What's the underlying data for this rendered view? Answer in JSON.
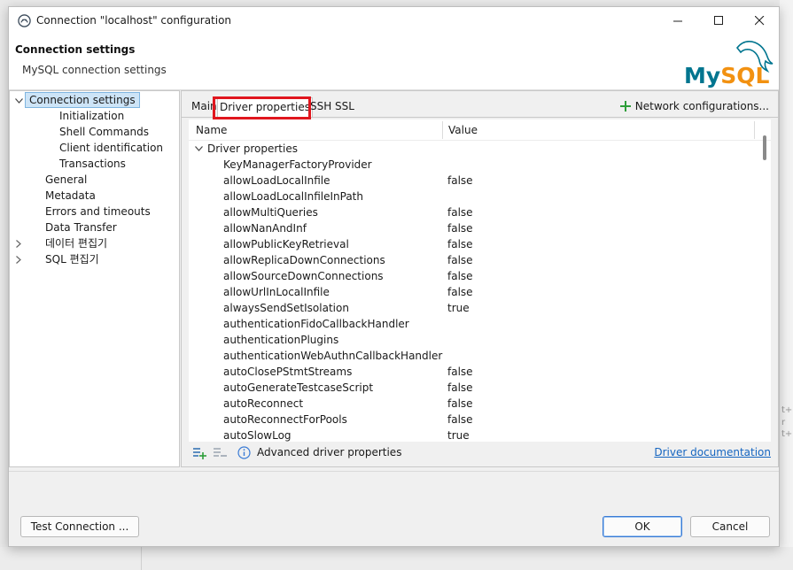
{
  "window": {
    "title": "Connection \"localhost\" configuration"
  },
  "header": {
    "title": "Connection settings",
    "subtitle": "MySQL connection settings",
    "logo_text": "MySQL"
  },
  "tree": {
    "items": [
      {
        "label": "Connection settings",
        "selected": true,
        "expanded": true
      },
      {
        "label": "Initialization"
      },
      {
        "label": "Shell Commands"
      },
      {
        "label": "Client identification"
      },
      {
        "label": "Transactions"
      },
      {
        "label": "General"
      },
      {
        "label": "Metadata"
      },
      {
        "label": "Errors and timeouts"
      },
      {
        "label": "Data Transfer"
      },
      {
        "label": "데이터 편집기",
        "collapsed": true
      },
      {
        "label": "SQL 편집기",
        "collapsed": true
      }
    ]
  },
  "tabs": [
    {
      "label": "Main"
    },
    {
      "label": "Driver properties",
      "active": true
    },
    {
      "label": "SSH"
    },
    {
      "label": "SSL"
    }
  ],
  "network_config_label": "Network configurations...",
  "grid": {
    "col_name": "Name",
    "col_value": "Value",
    "group_label": "Driver properties",
    "rows": [
      {
        "name": "KeyManagerFactoryProvider",
        "value": ""
      },
      {
        "name": "allowLoadLocalInfile",
        "value": "false"
      },
      {
        "name": "allowLoadLocalInfileInPath",
        "value": ""
      },
      {
        "name": "allowMultiQueries",
        "value": "false"
      },
      {
        "name": "allowNanAndInf",
        "value": "false"
      },
      {
        "name": "allowPublicKeyRetrieval",
        "value": "false"
      },
      {
        "name": "allowReplicaDownConnections",
        "value": "false"
      },
      {
        "name": "allowSourceDownConnections",
        "value": "false"
      },
      {
        "name": "allowUrlInLocalInfile",
        "value": "false"
      },
      {
        "name": "alwaysSendSetIsolation",
        "value": "true"
      },
      {
        "name": "authenticationFidoCallbackHandler",
        "value": ""
      },
      {
        "name": "authenticationPlugins",
        "value": ""
      },
      {
        "name": "authenticationWebAuthnCallbackHandler",
        "value": ""
      },
      {
        "name": "autoClosePStmtStreams",
        "value": "false"
      },
      {
        "name": "autoGenerateTestcaseScript",
        "value": "false"
      },
      {
        "name": "autoReconnect",
        "value": "false"
      },
      {
        "name": "autoReconnectForPools",
        "value": "false"
      },
      {
        "name": "autoSlowLog",
        "value": "true"
      }
    ]
  },
  "advanced_label": "Advanced driver properties",
  "doc_link": "Driver documentation",
  "buttons": {
    "test": "Test Connection ...",
    "ok": "OK",
    "cancel": "Cancel"
  },
  "backdrop_fragments": [
    "t+N",
    "r",
    "t+L"
  ],
  "colors": {
    "accent": "#3a7bd5",
    "selection": "#cde4f7",
    "highlight_box": "#e0161e",
    "link": "#1565c0",
    "mysql_blue": "#00758f",
    "mysql_orange": "#f29111"
  }
}
